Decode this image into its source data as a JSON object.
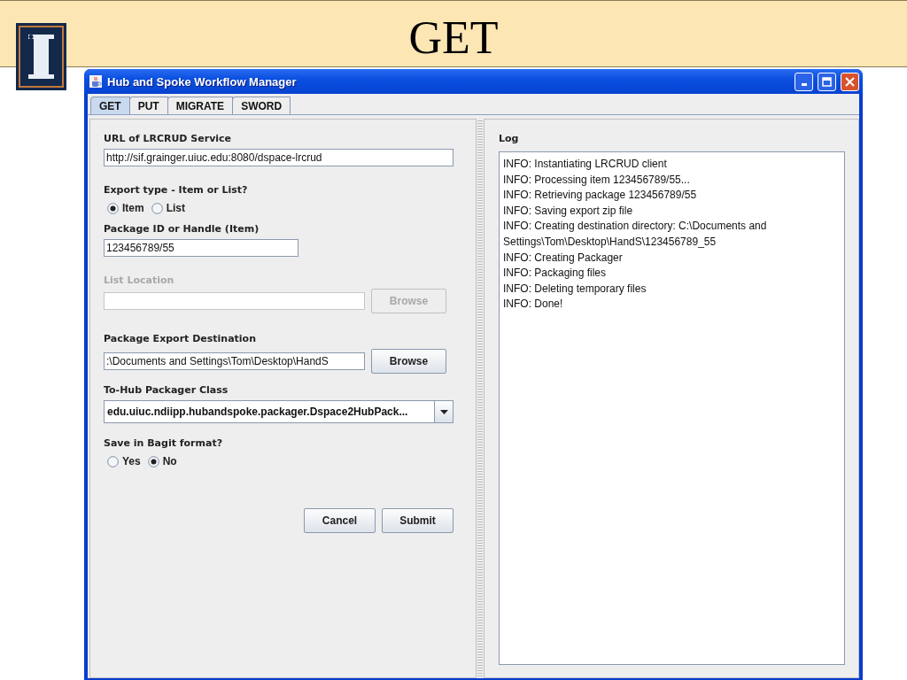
{
  "slide": {
    "title": "GET"
  },
  "window": {
    "title": "Hub and Spoke Workflow Manager"
  },
  "tabs": [
    {
      "label": "GET",
      "selected": true
    },
    {
      "label": "PUT",
      "selected": false
    },
    {
      "label": "MIGRATE",
      "selected": false
    },
    {
      "label": "SWORD",
      "selected": false
    }
  ],
  "form": {
    "fields": [
      {
        "kind": "text",
        "label": "URL of LRCRUD Service",
        "value": "http://sif.grainger.uiuc.edu:8080/dspace-lrcrud",
        "disabled": false
      },
      {
        "kind": "radio",
        "label": "Export type - Item or List?",
        "options": [
          {
            "label": "Item",
            "selected": true
          },
          {
            "label": "List",
            "selected": false
          }
        ]
      },
      {
        "kind": "text",
        "label": "Package ID or Handle (Item)",
        "value": "123456789/55",
        "disabled": false
      },
      {
        "kind": "browse",
        "label": "List Location",
        "button": "Browse",
        "disabled": true
      },
      {
        "kind": "browse",
        "label": "Package Export Destination",
        "value": ":\\Documents and Settings\\Tom\\Desktop\\HandS",
        "button": "Browse",
        "disabled": false
      },
      {
        "kind": "combo",
        "label": "To-Hub Packager Class",
        "value": "edu.uiuc.ndiipp.hubandspoke.packager.Dspace2HubPack..."
      },
      {
        "kind": "radio",
        "label": "Save in Bagit format?",
        "options": [
          {
            "label": "Yes",
            "selected": false
          },
          {
            "label": "No",
            "selected": true
          }
        ]
      }
    ],
    "buttons": [
      "Cancel",
      "Submit"
    ]
  },
  "log": {
    "label": "Log",
    "lines": [
      "INFO: Instantiating LRCRUD client",
      "INFO: Processing item 123456789/55...",
      "INFO: Retrieving package 123456789/55",
      "INFO: Saving export zip file",
      "INFO: Creating destination directory: C:\\Documents and Settings\\Tom\\Desktop\\HandS\\123456789_55",
      "INFO: Creating Packager",
      "INFO: Packaging files",
      "INFO: Deleting temporary files",
      "INFO: Done!"
    ]
  }
}
